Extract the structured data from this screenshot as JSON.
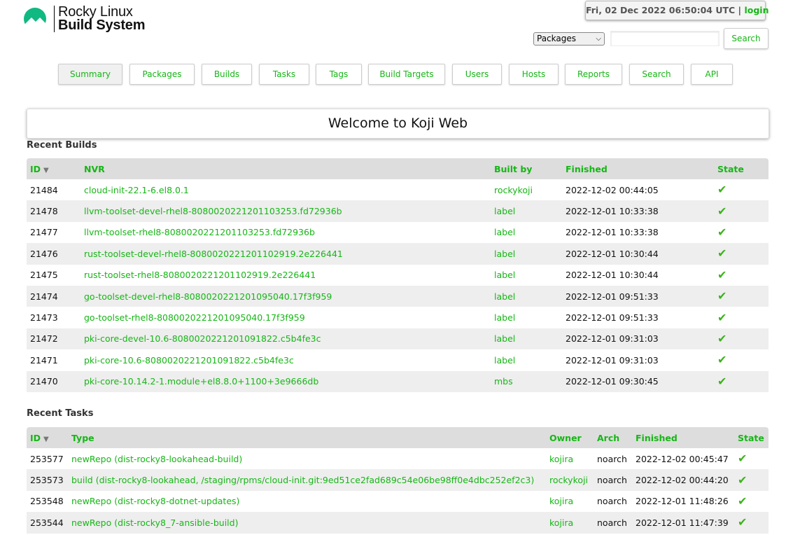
{
  "brand": {
    "line1": "Rocky Linux",
    "line2": "Build System"
  },
  "header": {
    "datetime": "Fri, 02 Dec 2022 06:50:04 UTC",
    "separator": "|",
    "login": "login"
  },
  "search": {
    "select_value": "Packages",
    "button": "Search"
  },
  "tabs": [
    "Summary",
    "Packages",
    "Builds",
    "Tasks",
    "Tags",
    "Build Targets",
    "Users",
    "Hosts",
    "Reports",
    "Search",
    "API"
  ],
  "welcome": "Welcome to Koji Web",
  "builds": {
    "title": "Recent Builds",
    "columns": [
      "ID",
      "NVR",
      "Built by",
      "Finished",
      "State"
    ],
    "rows": [
      {
        "id": "21484",
        "nvr": "cloud-init-22.1-6.el8.0.1",
        "by": "rockykoji",
        "finished": "2022-12-02 00:44:05"
      },
      {
        "id": "21478",
        "nvr": "llvm-toolset-devel-rhel8-8080020221201103253.fd72936b",
        "by": "label",
        "finished": "2022-12-01 10:33:38"
      },
      {
        "id": "21477",
        "nvr": "llvm-toolset-rhel8-8080020221201103253.fd72936b",
        "by": "label",
        "finished": "2022-12-01 10:33:38"
      },
      {
        "id": "21476",
        "nvr": "rust-toolset-devel-rhel8-8080020221201102919.2e226441",
        "by": "label",
        "finished": "2022-12-01 10:30:44"
      },
      {
        "id": "21475",
        "nvr": "rust-toolset-rhel8-8080020221201102919.2e226441",
        "by": "label",
        "finished": "2022-12-01 10:30:44"
      },
      {
        "id": "21474",
        "nvr": "go-toolset-devel-rhel8-8080020221201095040.17f3f959",
        "by": "label",
        "finished": "2022-12-01 09:51:33"
      },
      {
        "id": "21473",
        "nvr": "go-toolset-rhel8-8080020221201095040.17f3f959",
        "by": "label",
        "finished": "2022-12-01 09:51:33"
      },
      {
        "id": "21472",
        "nvr": "pki-core-devel-10.6-8080020221201091822.c5b4fe3c",
        "by": "label",
        "finished": "2022-12-01 09:31:03"
      },
      {
        "id": "21471",
        "nvr": "pki-core-10.6-8080020221201091822.c5b4fe3c",
        "by": "label",
        "finished": "2022-12-01 09:31:03"
      },
      {
        "id": "21470",
        "nvr": "pki-core-10.14.2-1.module+el8.8.0+1100+3e9666db",
        "by": "mbs",
        "finished": "2022-12-01 09:30:45"
      }
    ]
  },
  "tasks": {
    "title": "Recent Tasks",
    "columns": [
      "ID",
      "Type",
      "Owner",
      "Arch",
      "Finished",
      "State"
    ],
    "rows": [
      {
        "id": "253577",
        "type": "newRepo (dist-rocky8-lookahead-build)",
        "owner": "kojira",
        "arch": "noarch",
        "finished": "2022-12-02 00:45:47"
      },
      {
        "id": "253573",
        "type": "build (dist-rocky8-lookahead, /staging/rpms/cloud-init.git:9ed51ce2fad689c54e06be98ff0e4dbc252ef2c3)",
        "owner": "rockykoji",
        "arch": "noarch",
        "finished": "2022-12-02 00:44:20"
      },
      {
        "id": "253548",
        "type": "newRepo (dist-rocky8-dotnet-updates)",
        "owner": "kojira",
        "arch": "noarch",
        "finished": "2022-12-01 11:48:26"
      },
      {
        "id": "253544",
        "type": "newRepo (dist-rocky8_7-ansible-build)",
        "owner": "kojira",
        "arch": "noarch",
        "finished": "2022-12-01 11:47:39"
      }
    ]
  },
  "state_icon": "checkmark-icon",
  "colors": {
    "link": "#16b616",
    "header_bg": "#dddddd",
    "stripe": "#eeeeee",
    "logo": "#10b981"
  }
}
